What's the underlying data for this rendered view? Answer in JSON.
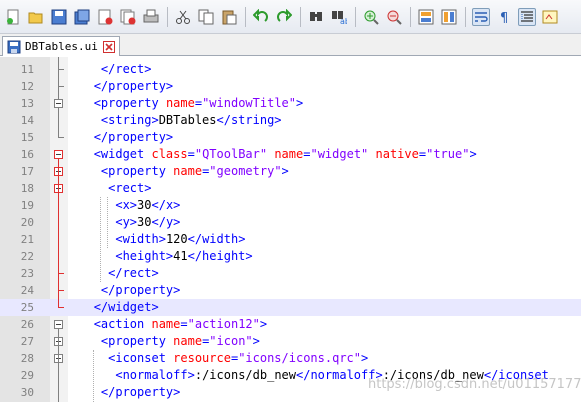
{
  "toolbar": {
    "icons": [
      "new-file-icon",
      "open-file-icon",
      "save-icon",
      "save-all-icon",
      "close-icon",
      "close-all-icon",
      "print-icon",
      "cut-icon",
      "copy-icon",
      "paste-icon",
      "undo-icon",
      "redo-icon",
      "find-icon",
      "replace-icon",
      "zoom-in-icon",
      "zoom-out-icon",
      "sync-vertical-icon",
      "sync-horizontal-icon",
      "word-wrap-icon",
      "show-all-chars-icon",
      "indent-guide-icon",
      "user-language-icon"
    ]
  },
  "tab": {
    "label": "DBTables.ui",
    "modified": true
  },
  "colors": {
    "tag": "#0000ff",
    "attr": "#ff0000",
    "string": "#8000ff",
    "text": "#000000",
    "current_line": "#e8e8ff",
    "fold_changed": "#e03030"
  },
  "editor": {
    "current_line": 25,
    "lines": [
      {
        "n": "11",
        "segs": [
          [
            "t",
            "    "
          ],
          [
            "tag",
            "</rect>"
          ]
        ]
      },
      {
        "n": "12",
        "segs": [
          [
            "t",
            "   "
          ],
          [
            "tag",
            "</property>"
          ]
        ]
      },
      {
        "n": "13",
        "segs": [
          [
            "t",
            "   "
          ],
          [
            "tag",
            "<property "
          ],
          [
            "attr",
            "name"
          ],
          [
            "tag",
            "="
          ],
          [
            "str",
            "\"windowTitle\""
          ],
          [
            "tag",
            ">"
          ]
        ]
      },
      {
        "n": "14",
        "segs": [
          [
            "t",
            "    "
          ],
          [
            "tag",
            "<string>"
          ],
          [
            "t",
            "DBTables"
          ],
          [
            "tag",
            "</string>"
          ]
        ]
      },
      {
        "n": "15",
        "segs": [
          [
            "t",
            "   "
          ],
          [
            "tag",
            "</property>"
          ]
        ]
      },
      {
        "n": "16",
        "segs": [
          [
            "t",
            "   "
          ],
          [
            "tag",
            "<widget "
          ],
          [
            "attr",
            "class"
          ],
          [
            "tag",
            "="
          ],
          [
            "str",
            "\"QToolBar\""
          ],
          [
            "tag",
            " "
          ],
          [
            "attr",
            "name"
          ],
          [
            "tag",
            "="
          ],
          [
            "str",
            "\"widget\""
          ],
          [
            "tag",
            " "
          ],
          [
            "attr",
            "native"
          ],
          [
            "tag",
            "="
          ],
          [
            "str",
            "\"true\""
          ],
          [
            "tag",
            ">"
          ]
        ]
      },
      {
        "n": "17",
        "segs": [
          [
            "t",
            "    "
          ],
          [
            "tag",
            "<property "
          ],
          [
            "attr",
            "name"
          ],
          [
            "tag",
            "="
          ],
          [
            "str",
            "\"geometry\""
          ],
          [
            "tag",
            ">"
          ]
        ]
      },
      {
        "n": "18",
        "segs": [
          [
            "t",
            "     "
          ],
          [
            "tag",
            "<rect>"
          ]
        ]
      },
      {
        "n": "19",
        "segs": [
          [
            "t",
            "      "
          ],
          [
            "tag",
            "<x>"
          ],
          [
            "t",
            "30"
          ],
          [
            "tag",
            "</x>"
          ]
        ]
      },
      {
        "n": "20",
        "segs": [
          [
            "t",
            "      "
          ],
          [
            "tag",
            "<y>"
          ],
          [
            "t",
            "30"
          ],
          [
            "tag",
            "</y>"
          ]
        ]
      },
      {
        "n": "21",
        "segs": [
          [
            "t",
            "      "
          ],
          [
            "tag",
            "<width>"
          ],
          [
            "t",
            "120"
          ],
          [
            "tag",
            "</width>"
          ]
        ]
      },
      {
        "n": "22",
        "segs": [
          [
            "t",
            "      "
          ],
          [
            "tag",
            "<height>"
          ],
          [
            "t",
            "41"
          ],
          [
            "tag",
            "</height>"
          ]
        ]
      },
      {
        "n": "23",
        "segs": [
          [
            "t",
            "     "
          ],
          [
            "tag",
            "</rect>"
          ]
        ]
      },
      {
        "n": "24",
        "segs": [
          [
            "t",
            "    "
          ],
          [
            "tag",
            "</property>"
          ]
        ]
      },
      {
        "n": "25",
        "segs": [
          [
            "t",
            "   "
          ],
          [
            "tag",
            "</widget>"
          ]
        ]
      },
      {
        "n": "26",
        "segs": [
          [
            "t",
            "   "
          ],
          [
            "tag",
            "<action "
          ],
          [
            "attr",
            "name"
          ],
          [
            "tag",
            "="
          ],
          [
            "str",
            "\"action12\""
          ],
          [
            "tag",
            ">"
          ]
        ]
      },
      {
        "n": "27",
        "segs": [
          [
            "t",
            "    "
          ],
          [
            "tag",
            "<property "
          ],
          [
            "attr",
            "name"
          ],
          [
            "tag",
            "="
          ],
          [
            "str",
            "\"icon\""
          ],
          [
            "tag",
            ">"
          ]
        ]
      },
      {
        "n": "28",
        "segs": [
          [
            "t",
            "     "
          ],
          [
            "tag",
            "<iconset "
          ],
          [
            "attr",
            "resource"
          ],
          [
            "tag",
            "="
          ],
          [
            "str",
            "\"icons/icons.qrc\""
          ],
          [
            "tag",
            ">"
          ]
        ]
      },
      {
        "n": "29",
        "segs": [
          [
            "t",
            "      "
          ],
          [
            "tag",
            "<normaloff>"
          ],
          [
            "t",
            ":/icons/db_new"
          ],
          [
            "tag",
            "</normaloff>"
          ],
          [
            "t",
            ":/icons/db_new"
          ],
          [
            "tag",
            "</iconset"
          ]
        ]
      },
      {
        "n": "30",
        "segs": [
          [
            "t",
            "    "
          ],
          [
            "tag",
            "</property>"
          ]
        ]
      }
    ]
  },
  "watermark": "https://blog.csdn.net/u011571773"
}
